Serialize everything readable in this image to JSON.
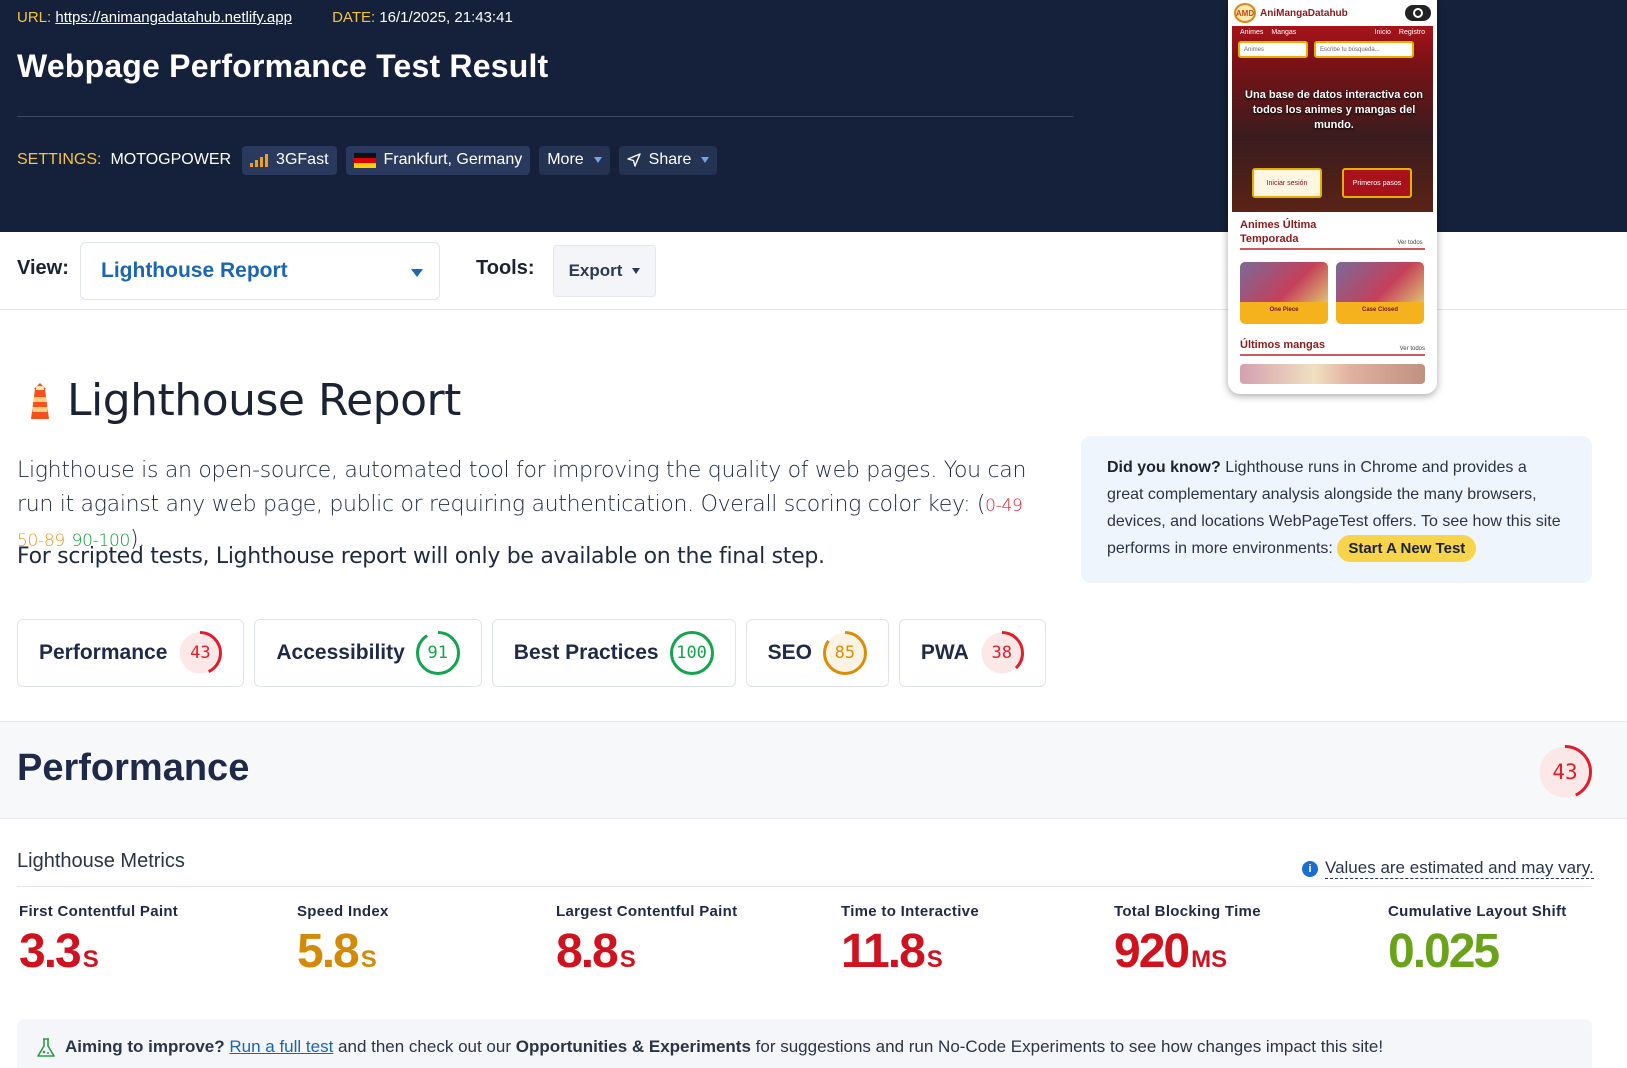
{
  "header": {
    "url_label": "URL:",
    "url": "https://animangadatahub.netlify.app",
    "date_label": "DATE:",
    "date": "16/1/2025, 21:43:41",
    "title": "Webpage Performance Test Result",
    "settings_label": "SETTINGS:",
    "settings_device": "MOTOGPOWER",
    "connection": "3GFast",
    "location": "Frankfurt, Germany",
    "more_label": "More",
    "share_label": "Share"
  },
  "viewbar": {
    "view_label": "View:",
    "view_value": "Lighthouse Report",
    "tools_label": "Tools:",
    "export_label": "Export"
  },
  "preview": {
    "brand": "AniMangaDatahub",
    "logo_text": "AMD",
    "nav_animes": "Animes",
    "nav_mangas": "Mangas",
    "nav_login": "Inicio",
    "nav_register": "Registro",
    "select_value": "Animes",
    "search_placeholder": "Escribe tu búsqueda...",
    "tagline": "Una base de datos interactiva con todos los animes y mangas del mundo.",
    "btn_login": "Iniciar sesión",
    "btn_first": "Primeros pasos",
    "section1": "Animes Última Temporada",
    "see_all_1": "Ver todos",
    "card1": "One Piece",
    "card2": "Case Closed",
    "section2": "Últimos mangas",
    "see_all_2": "Ver todos"
  },
  "report": {
    "title": "Lighthouse Report",
    "intro": "Lighthouse is an open-source, automated tool for improving the quality of web pages. You can run it against any web page, public or requiring authentication. Overall scoring color key: (",
    "key_red": "0-49",
    "key_amber": "50-89",
    "key_green": "90-100",
    "intro_end": ").",
    "scripted_note": "For scripted tests, Lighthouse report will only be available on the final step.",
    "did_you_know_label": "Did you know?",
    "did_you_know_text": " Lighthouse runs in Chrome and provides a great complementary analysis alongside the many browsers, devices, and locations WebPageTest offers. To see how this site performs in more environments: ",
    "start_test_label": "Start A New Test"
  },
  "scores": [
    {
      "name": "Performance",
      "score": 43,
      "level": "red"
    },
    {
      "name": "Accessibility",
      "score": 91,
      "level": "green"
    },
    {
      "name": "Best Practices",
      "score": 100,
      "level": "green"
    },
    {
      "name": "SEO",
      "score": 85,
      "level": "amber"
    },
    {
      "name": "PWA",
      "score": 38,
      "level": "red"
    }
  ],
  "performance": {
    "heading": "Performance",
    "score": 43,
    "metrics_heading": "Lighthouse Metrics",
    "estimate_note": "Values are estimated and may vary.",
    "metrics": [
      {
        "label": "First Contentful Paint",
        "value": "3.3",
        "unit": "S",
        "level": "red"
      },
      {
        "label": "Speed Index",
        "value": "5.8",
        "unit": "S",
        "level": "amber"
      },
      {
        "label": "Largest Contentful Paint",
        "value": "8.8",
        "unit": "S",
        "level": "red"
      },
      {
        "label": "Time to Interactive",
        "value": "11.8",
        "unit": "S",
        "level": "red"
      },
      {
        "label": "Total Blocking Time",
        "value": "920",
        "unit": "MS",
        "level": "red"
      },
      {
        "label": "Cumulative Layout Shift",
        "value": "0.025",
        "unit": "",
        "level": "green"
      }
    ]
  },
  "tip": {
    "lead": "Aiming to improve?",
    "link": "Run a full test",
    "mid": " and then check out our ",
    "bold": "Opportunities & Experiments",
    "end": " for suggestions and run No-Code Experiments to see how changes impact this site!"
  },
  "colors": {
    "red": "#e11d2b",
    "amber": "#d98e06",
    "green": "#14a44d",
    "metric_red": "#d0121f",
    "metric_amber": "#d38a07",
    "metric_green": "#6aa21a",
    "header_bg": "#15203a",
    "accent_blue": "#1b66b1"
  }
}
